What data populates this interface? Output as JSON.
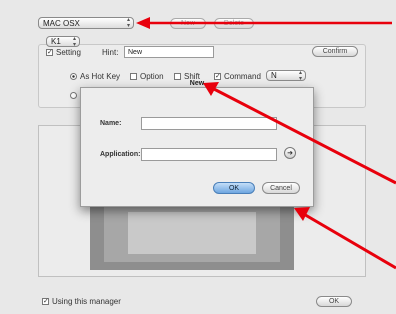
{
  "toolbar": {
    "os_select": "MAC OSX",
    "new_label": "New",
    "delete_label": "Delete"
  },
  "group": {
    "key_select": "K1",
    "setting_label": "Setting",
    "hint_label": "Hint:",
    "hint_value": "New",
    "confirm_label": "Confirm",
    "as_hot_key_label": "As Hot Key",
    "option_label": "Option",
    "shift_label": "Shift",
    "command_label": "Command",
    "key_value": "N"
  },
  "dialog": {
    "title": "New",
    "name_label": "Name:",
    "name_value": "",
    "application_label": "Application:",
    "application_value": "",
    "browse_icon": "arrow-right-icon",
    "ok_label": "OK",
    "cancel_label": "Cancel"
  },
  "footer": {
    "using_manager_label": "Using this manager",
    "ok_label": "OK"
  },
  "colors": {
    "annotation_arrow": "#e8000c",
    "primary_button": "#7fb2e8"
  }
}
